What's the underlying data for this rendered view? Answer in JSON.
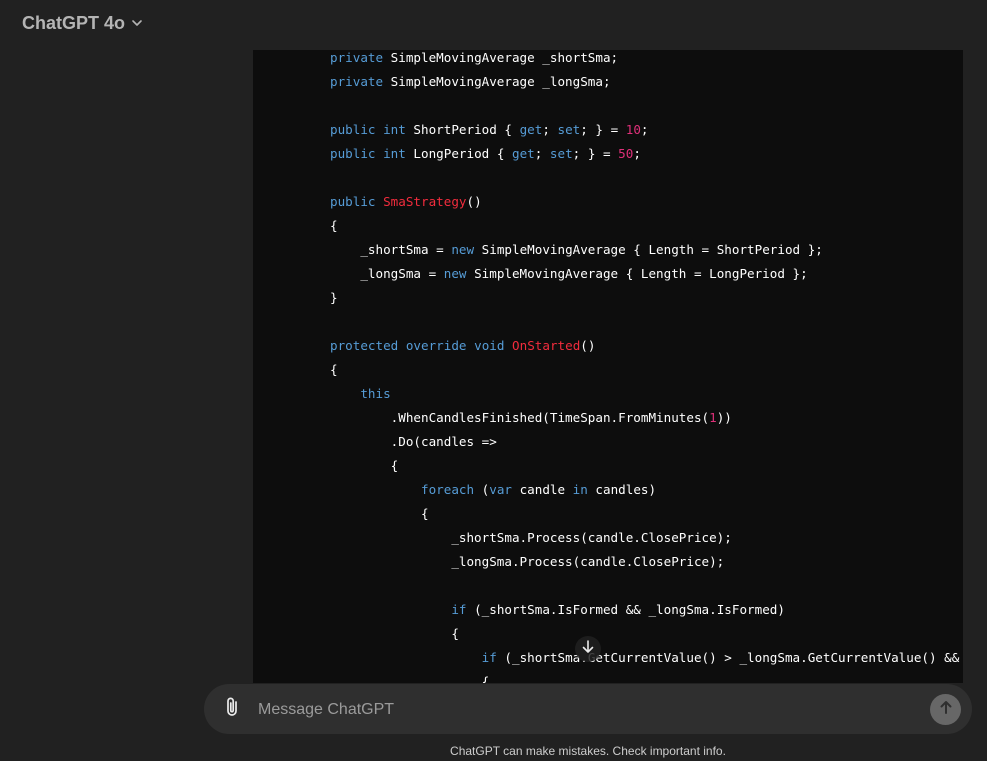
{
  "header": {
    "model_label": "ChatGPT 4o"
  },
  "code_lines": [
    [
      {
        "t": "private",
        "c": "kw"
      },
      {
        "t": " SimpleMovingAverage _shortSma;"
      }
    ],
    [
      {
        "t": "private",
        "c": "kw"
      },
      {
        "t": " SimpleMovingAverage _longSma;"
      }
    ],
    [],
    [
      {
        "t": "public",
        "c": "kw"
      },
      {
        "t": " "
      },
      {
        "t": "int",
        "c": "ty"
      },
      {
        "t": " ShortPeriod { "
      },
      {
        "t": "get",
        "c": "kw"
      },
      {
        "t": "; "
      },
      {
        "t": "set",
        "c": "kw"
      },
      {
        "t": "; } = "
      },
      {
        "t": "10",
        "c": "num"
      },
      {
        "t": ";"
      }
    ],
    [
      {
        "t": "public",
        "c": "kw"
      },
      {
        "t": " "
      },
      {
        "t": "int",
        "c": "ty"
      },
      {
        "t": " LongPeriod { "
      },
      {
        "t": "get",
        "c": "kw"
      },
      {
        "t": "; "
      },
      {
        "t": "set",
        "c": "kw"
      },
      {
        "t": "; } = "
      },
      {
        "t": "50",
        "c": "num"
      },
      {
        "t": ";"
      }
    ],
    [],
    [
      {
        "t": "public",
        "c": "kw"
      },
      {
        "t": " "
      },
      {
        "t": "SmaStrategy",
        "c": "fn"
      },
      {
        "t": "()"
      }
    ],
    [
      {
        "t": "{"
      }
    ],
    [
      {
        "t": "    _shortSma = "
      },
      {
        "t": "new",
        "c": "kw"
      },
      {
        "t": " SimpleMovingAverage { Length = ShortPeriod };"
      }
    ],
    [
      {
        "t": "    _longSma = "
      },
      {
        "t": "new",
        "c": "kw"
      },
      {
        "t": " SimpleMovingAverage { Length = LongPeriod };"
      }
    ],
    [
      {
        "t": "}"
      }
    ],
    [],
    [
      {
        "t": "protected",
        "c": "kw"
      },
      {
        "t": " "
      },
      {
        "t": "override",
        "c": "kw"
      },
      {
        "t": " "
      },
      {
        "t": "void",
        "c": "kw"
      },
      {
        "t": " "
      },
      {
        "t": "OnStarted",
        "c": "fn"
      },
      {
        "t": "()"
      }
    ],
    [
      {
        "t": "{"
      }
    ],
    [
      {
        "t": "    "
      },
      {
        "t": "this",
        "c": "kw"
      }
    ],
    [
      {
        "t": "        .WhenCandlesFinished(TimeSpan.FromMinutes("
      },
      {
        "t": "1",
        "c": "num"
      },
      {
        "t": "))"
      }
    ],
    [
      {
        "t": "        .Do(candles =>"
      }
    ],
    [
      {
        "t": "        {"
      }
    ],
    [
      {
        "t": "            "
      },
      {
        "t": "foreach",
        "c": "kw"
      },
      {
        "t": " ("
      },
      {
        "t": "var",
        "c": "kw"
      },
      {
        "t": " candle "
      },
      {
        "t": "in",
        "c": "kw"
      },
      {
        "t": " candles)"
      }
    ],
    [
      {
        "t": "            {"
      }
    ],
    [
      {
        "t": "                _shortSma.Process(candle.ClosePrice);"
      }
    ],
    [
      {
        "t": "                _longSma.Process(candle.ClosePrice);"
      }
    ],
    [],
    [
      {
        "t": "                "
      },
      {
        "t": "if",
        "c": "kw"
      },
      {
        "t": " (_shortSma.IsFormed && _longSma.IsFormed)"
      }
    ],
    [
      {
        "t": "                {"
      }
    ],
    [
      {
        "t": "                    "
      },
      {
        "t": "if",
        "c": "kw"
      },
      {
        "t": " (_shortSma.GetCurrentValue() > _longSma.GetCurrentValue() &&"
      }
    ],
    [
      {
        "t": "                    {"
      }
    ]
  ],
  "composer": {
    "placeholder": "Message ChatGPT",
    "attach_icon": "paperclip-icon",
    "send_icon": "arrow-up-icon"
  },
  "scroll_icon": "arrow-down-icon",
  "footer": {
    "disclaimer": "ChatGPT can make mistakes. Check important info."
  },
  "colors": {
    "background": "#212121",
    "code_background": "#0d0d0d",
    "keyword": "#569cd6",
    "function": "#f22c3d",
    "number": "#df3079",
    "composer": "#2f2f2f"
  }
}
